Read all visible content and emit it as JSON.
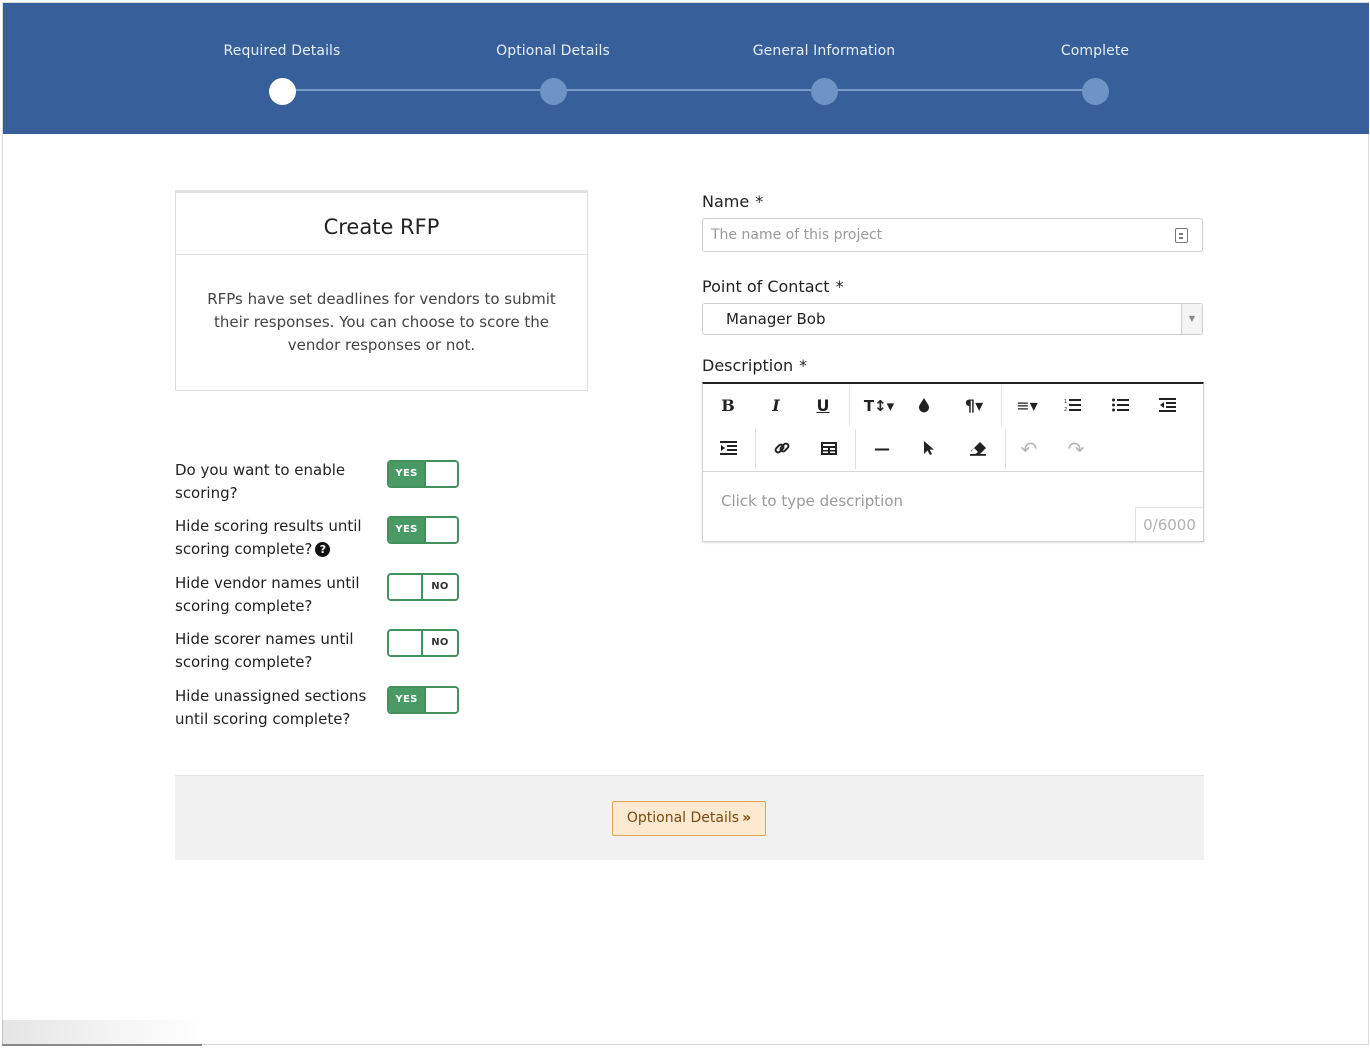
{
  "stepper": {
    "steps": [
      {
        "label": "Required Details",
        "active": true
      },
      {
        "label": "Optional Details",
        "active": false
      },
      {
        "label": "General Information",
        "active": false
      },
      {
        "label": "Complete",
        "active": false
      }
    ],
    "colors": {
      "bar": "#37609a",
      "active_dot": "#ffffff",
      "inactive_dot": "#6e93c4"
    }
  },
  "card": {
    "title": "Create RFP",
    "body": "RFPs have set deadlines for vendors to submit their responses. You can choose to score the vendor responses or not."
  },
  "toggles": [
    {
      "question": "Do you want to enable scoring?",
      "state": "YES",
      "help_icon": false
    },
    {
      "question": "Hide scoring results until scoring complete?",
      "state": "YES",
      "help_icon": true
    },
    {
      "question": "Hide vendor names until scoring complete?",
      "state": "NO",
      "help_icon": false
    },
    {
      "question": "Hide scorer names until scoring complete?",
      "state": "NO",
      "help_icon": false
    },
    {
      "question": "Hide unassigned sections until scoring complete?",
      "state": "YES",
      "help_icon": false
    }
  ],
  "form": {
    "name": {
      "label": "Name",
      "required_mark": "*",
      "value": "",
      "placeholder": "The name of this project"
    },
    "point_of_contact": {
      "label": "Point of Contact",
      "required_mark": "*",
      "value": "Manager Bob"
    },
    "description": {
      "label": "Description",
      "required_mark": "*",
      "placeholder": "Click to type description",
      "counter": "0/6000",
      "toolbar_icons": [
        "bold-icon",
        "italic-icon",
        "underline-icon",
        "font-size-icon",
        "color-drop-icon",
        "paragraph-icon",
        "align-icon",
        "ordered-list-icon",
        "unordered-list-icon",
        "outdent-icon",
        "indent-icon",
        "link-icon",
        "table-icon",
        "horizontal-rule-icon",
        "select-cursor-icon",
        "eraser-icon",
        "undo-icon",
        "redo-icon"
      ]
    }
  },
  "footer": {
    "next_button": "Optional Details",
    "next_icon": "double-chevron-right-icon"
  },
  "colors": {
    "toggle_green": "#4a9a66",
    "button_bg": "#fde9cf",
    "button_border": "#e3a34e"
  }
}
